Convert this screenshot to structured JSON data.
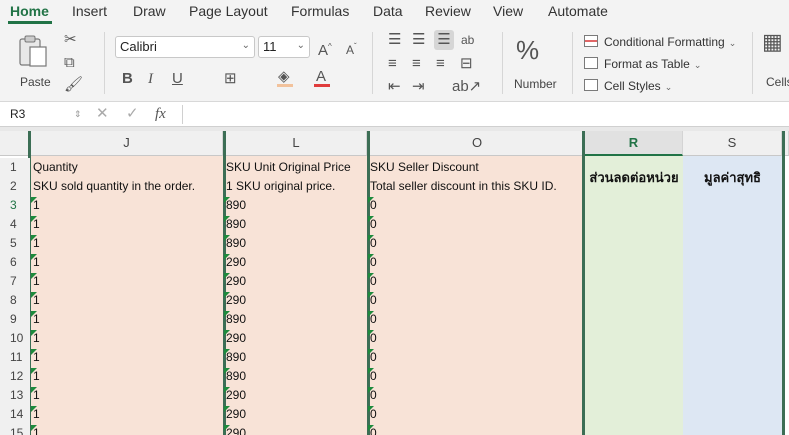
{
  "ribbon_tabs": [
    "Home",
    "Insert",
    "Draw",
    "Page Layout",
    "Formulas",
    "Data",
    "Review",
    "View",
    "Automate"
  ],
  "clipboard": {
    "paste_label": "Paste"
  },
  "font": {
    "name": "Calibri",
    "size": "11"
  },
  "number": {
    "label": "Number",
    "percent_glyph": "%"
  },
  "styles": {
    "conditional_formatting": "Conditional Formatting",
    "format_as_table": "Format as Table",
    "cell_styles": "Cell Styles",
    "cells_label": "Cells"
  },
  "formula_bar": {
    "name_box": "R3",
    "fx": "fx",
    "value": ""
  },
  "columns": [
    {
      "letter": "J"
    },
    {
      "letter": "L"
    },
    {
      "letter": "O"
    },
    {
      "letter": "R"
    },
    {
      "letter": "S"
    }
  ],
  "header_rows": {
    "J": [
      "Quantity",
      "SKU sold quantity in the order."
    ],
    "L": [
      "SKU Unit Original Price",
      "1 SKU original price."
    ],
    "O": [
      "SKU Seller Discount",
      "Total seller discount in this SKU ID."
    ],
    "R": "ส่วนลดต่อหน่วย",
    "S": "มูลค่าสุทธิ"
  },
  "row_numbers": [
    "1",
    "2",
    "3",
    "4",
    "5",
    "6",
    "7",
    "8",
    "9",
    "10",
    "11",
    "12",
    "13",
    "14",
    "15"
  ],
  "rows": [
    {
      "row": "3",
      "quantity": "1",
      "price": "890",
      "discount": "0"
    },
    {
      "row": "4",
      "quantity": "1",
      "price": "890",
      "discount": "0"
    },
    {
      "row": "5",
      "quantity": "1",
      "price": "890",
      "discount": "0"
    },
    {
      "row": "6",
      "quantity": "1",
      "price": "290",
      "discount": "0"
    },
    {
      "row": "7",
      "quantity": "1",
      "price": "290",
      "discount": "0"
    },
    {
      "row": "8",
      "quantity": "1",
      "price": "290",
      "discount": "0"
    },
    {
      "row": "9",
      "quantity": "1",
      "price": "890",
      "discount": "0"
    },
    {
      "row": "10",
      "quantity": "1",
      "price": "290",
      "discount": "0"
    },
    {
      "row": "11",
      "quantity": "1",
      "price": "890",
      "discount": "0"
    },
    {
      "row": "12",
      "quantity": "1",
      "price": "890",
      "discount": "0"
    },
    {
      "row": "13",
      "quantity": "1",
      "price": "290",
      "discount": "0"
    },
    {
      "row": "14",
      "quantity": "1",
      "price": "290",
      "discount": "0"
    },
    {
      "row": "15",
      "quantity": "1",
      "price": "290",
      "discount": "0"
    }
  ],
  "colors": {
    "accent": "#217346",
    "orange_fill": "#f8e3d7",
    "green_fill": "#e3efd9",
    "blue_fill": "#dde7f3",
    "error_flag": "#1e8a3c"
  }
}
